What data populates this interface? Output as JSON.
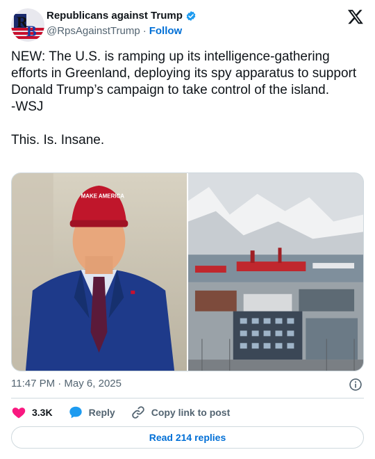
{
  "author": {
    "display_name": "Republicans against Trump",
    "handle": "@RpsAgainstTrump",
    "separator": "·",
    "follow_label": "Follow",
    "avatar_text": "RB",
    "verified": true,
    "accent_color": "#1d9bf0"
  },
  "tweet": {
    "text": "NEW: The U.S. is ramping up its intelligence-gathering efforts in Greenland, deploying its spy apparatus to support Donald Trump’s campaign to take control of the island.\n-WSJ\n\nThis. Is. Insane.",
    "media": [
      {
        "description_icon": "photo-icon"
      },
      {
        "description_icon": "photo-icon"
      }
    ],
    "timestamp": "11:47 PM · May 6, 2025"
  },
  "actions": {
    "likes": "3.3K",
    "reply_label": "Reply",
    "copy_link_label": "Copy link to post",
    "read_replies_label": "Read 214 replies"
  },
  "colors": {
    "like": "#f91880",
    "reply": "#1d9bf0",
    "link": "#006fd6",
    "muted": "#536471"
  }
}
